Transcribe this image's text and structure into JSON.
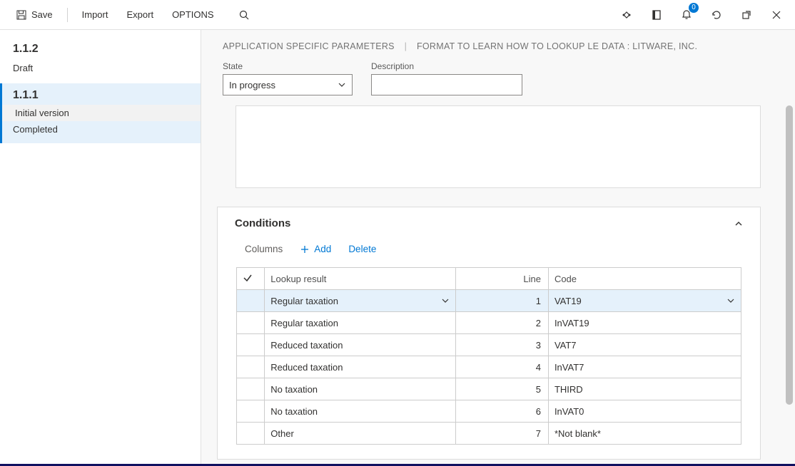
{
  "toolbar": {
    "save": "Save",
    "import": "Import",
    "export": "Export",
    "options": "OPTIONS"
  },
  "notification_count": "0",
  "sidebar": {
    "versions": [
      {
        "number": "1.1.2",
        "status": "Draft",
        "selected": false
      },
      {
        "number": "1.1.1",
        "sub1": "Initial version",
        "sub2": "Completed",
        "selected": true
      }
    ]
  },
  "breadcrumb": {
    "part1": "APPLICATION SPECIFIC PARAMETERS",
    "part2": "FORMAT TO LEARN HOW TO LOOKUP LE DATA : LITWARE, INC."
  },
  "form": {
    "state_label": "State",
    "state_value": "In progress",
    "description_label": "Description",
    "description_value": ""
  },
  "conditions": {
    "title": "Conditions",
    "columns_label": "Columns",
    "add_label": "Add",
    "delete_label": "Delete",
    "headers": {
      "lookup": "Lookup result",
      "line": "Line",
      "code": "Code"
    },
    "rows": [
      {
        "lookup": "Regular taxation",
        "line": "1",
        "code": "VAT19",
        "selected": true
      },
      {
        "lookup": "Regular taxation",
        "line": "2",
        "code": "InVAT19",
        "selected": false
      },
      {
        "lookup": "Reduced taxation",
        "line": "3",
        "code": "VAT7",
        "selected": false
      },
      {
        "lookup": "Reduced taxation",
        "line": "4",
        "code": "InVAT7",
        "selected": false
      },
      {
        "lookup": "No taxation",
        "line": "5",
        "code": "THIRD",
        "selected": false
      },
      {
        "lookup": "No taxation",
        "line": "6",
        "code": "InVAT0",
        "selected": false
      },
      {
        "lookup": "Other",
        "line": "7",
        "code": "*Not blank*",
        "selected": false
      }
    ]
  }
}
